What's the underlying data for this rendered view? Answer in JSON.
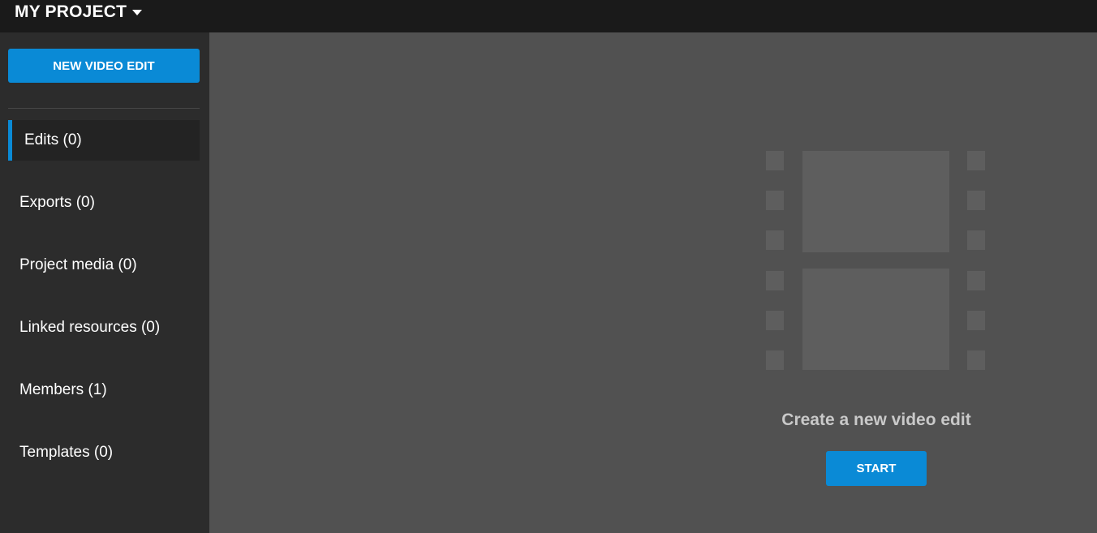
{
  "header": {
    "project_title": "MY PROJECT",
    "dropdown_icon": "caret-down-icon"
  },
  "sidebar": {
    "new_edit_label": "NEW VIDEO EDIT",
    "items": [
      {
        "label": "Edits (0)",
        "active": true
      },
      {
        "label": "Exports (0)",
        "active": false
      },
      {
        "label": "Project media (0)",
        "active": false
      },
      {
        "label": "Linked resources (0)",
        "active": false
      },
      {
        "label": "Members (1)",
        "active": false
      },
      {
        "label": "Templates (0)",
        "active": false
      }
    ]
  },
  "main": {
    "empty_icon": "film-strip-icon",
    "empty_title": "Create a new video edit",
    "start_label": "START"
  },
  "colors": {
    "accent": "#0a8ad6",
    "topbar": "#1a1a1a",
    "sidebar": "#2c2c2c",
    "content": "#515151",
    "active_item": "#232323",
    "icon_fill": "#5e5e5e"
  }
}
